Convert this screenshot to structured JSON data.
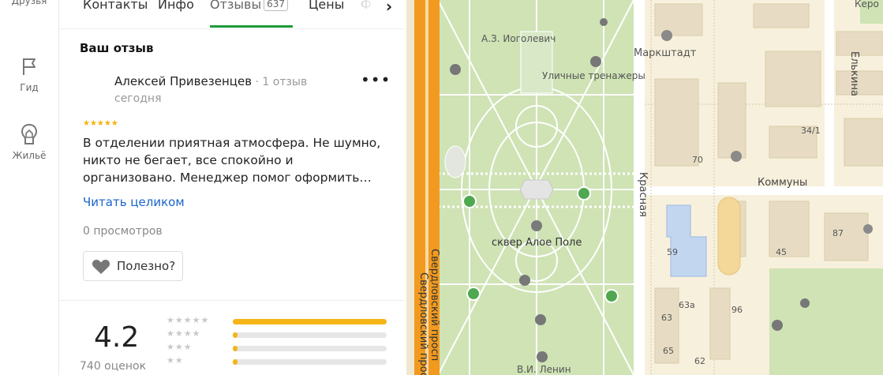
{
  "nav": {
    "items": [
      {
        "label": "Друзья",
        "icon": "friends-icon"
      },
      {
        "label": "Гид",
        "icon": "flag-icon"
      },
      {
        "label": "Жильё",
        "icon": "house-icon"
      }
    ]
  },
  "tabs": {
    "items": [
      {
        "label": "Контакты"
      },
      {
        "label": "Инфо"
      },
      {
        "label": "Отзывы",
        "count": "637",
        "active": true
      },
      {
        "label": "Цены"
      },
      {
        "label": "Ф"
      }
    ],
    "next_icon": "chevron-right-icon"
  },
  "review": {
    "section_title": "Ваш отзыв",
    "author": "Алексей Привезенцев",
    "author_meta": " · 1 отзыв",
    "date": "сегодня",
    "stars": "★★★★★",
    "rating": 5,
    "text": "В отделении приятная атмосфера. Не шумно, никто не бегает, все спокойно и организовано. Менеджер помог оформить…",
    "read_more": "Читать целиком",
    "views": "0 просмотров",
    "useful_label": "Полезно?"
  },
  "summary": {
    "rating": "4.2",
    "count_label": "740 оценок",
    "distribution": [
      {
        "stars": "★★★★★",
        "fraction": 1.0
      },
      {
        "stars": "★★★★",
        "fraction": 0.03
      },
      {
        "stars": "★★★",
        "fraction": 0.03
      },
      {
        "stars": "★★",
        "fraction": 0.03
      }
    ]
  },
  "map": {
    "labels": {
      "park_name": "сквер Алое Поле",
      "iogolevich": "А.З. Иоголевич",
      "workout": "Уличные тренажеры",
      "marksht": "Маркштадт",
      "elkina": "Елькина",
      "kommuny": "Коммуны",
      "krasnaya": "Красная",
      "sverdl1": "Свердловский просп",
      "sverdl2": "Свердловский прос",
      "lenin": "В.И. Ленин",
      "kero": "Керо",
      "n70": "70",
      "n341": "34/1",
      "n59": "59",
      "n45": "45",
      "n87": "87",
      "n63a": "63а",
      "n63": "63",
      "n96": "96",
      "n65": "65",
      "n62": "62"
    },
    "colors": {
      "park": "#cfe3b5",
      "path": "#ffffff",
      "road_major": "#f29a1f",
      "block": "#f7f0dc",
      "building": "#e7dcc3",
      "blue": "#c2d6f0"
    }
  }
}
